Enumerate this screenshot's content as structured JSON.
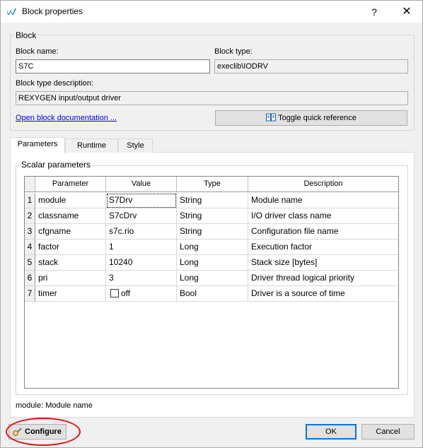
{
  "window": {
    "title": "Block properties",
    "help_label": "?",
    "close_label": "✕"
  },
  "block": {
    "group_title": "Block",
    "name_label": "Block name:",
    "name_value": "S7C",
    "type_label": "Block type:",
    "type_value": "execlib\\IODRV",
    "desc_label": "Block type description:",
    "desc_value": "REXYGEN input/output driver",
    "doc_link": "Open block documentation ...",
    "quick_ref_label": "Toggle quick reference"
  },
  "tabs": [
    {
      "label": "Parameters",
      "active": true
    },
    {
      "label": "Runtime",
      "active": false
    },
    {
      "label": "Style",
      "active": false
    }
  ],
  "scalar": {
    "group_title": "Scalar parameters",
    "columns": [
      "Parameter",
      "Value",
      "Type",
      "Description"
    ],
    "rows": [
      {
        "num": "1",
        "param": "module",
        "value": "S7Drv",
        "type": "String",
        "desc": "Module name"
      },
      {
        "num": "2",
        "param": "classname",
        "value": "S7cDrv",
        "type": "String",
        "desc": "I/O driver class name"
      },
      {
        "num": "3",
        "param": "cfgname",
        "value": "s7c.rio",
        "type": "String",
        "desc": "Configuration file name"
      },
      {
        "num": "4",
        "param": "factor",
        "value": "1",
        "type": "Long",
        "desc": "Execution factor"
      },
      {
        "num": "5",
        "param": "stack",
        "value": "10240",
        "type": "Long",
        "desc": "Stack size [bytes]"
      },
      {
        "num": "6",
        "param": "pri",
        "value": "3",
        "type": "Long",
        "desc": "Driver thread logical priority"
      },
      {
        "num": "7",
        "param": "timer",
        "value": "off",
        "type": "Bool",
        "desc": "Driver is a source of time"
      }
    ]
  },
  "status_text": "module: Module name",
  "buttons": {
    "configure": "Configure",
    "ok": "OK",
    "cancel": "Cancel"
  },
  "colors": {
    "accent": "#0078d7",
    "link": "#0000ee",
    "highlight": "#e01010"
  }
}
